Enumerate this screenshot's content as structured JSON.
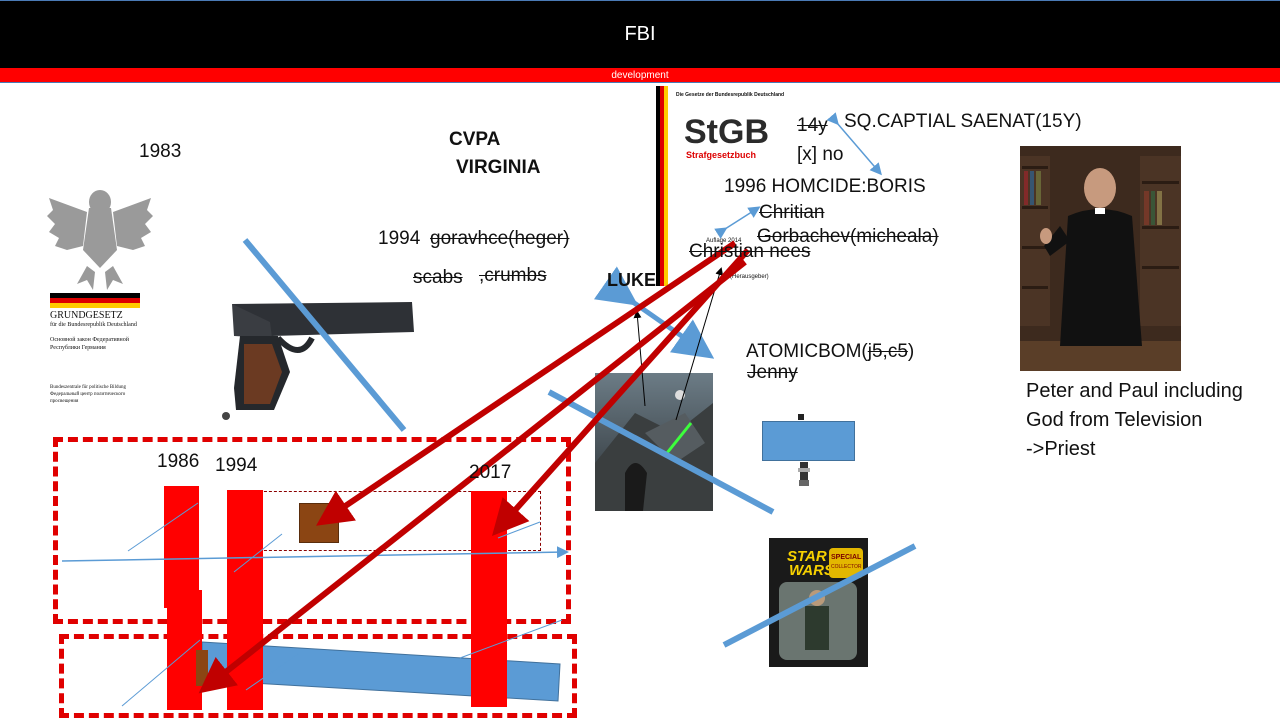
{
  "header": {
    "title": "FBI",
    "subtitle": "development"
  },
  "labels": {
    "year_1983": "1983",
    "cvpa": "CVPA",
    "virginia": "VIRGINIA",
    "year_1994": "1994",
    "goravhce": "goravhce(heger)",
    "scabs": "scabs",
    "crumbs": ",crumbs",
    "luke": "LUKE",
    "age_14y": "14y",
    "sq_captial": "SQ.CAPTIAL SAENAT(15Y)",
    "x_no": "[x] no",
    "homcide": "1996 HOMCIDE:BORIS",
    "chritian": "Chritian",
    "gorbachev": "Gorbachev(micheala)",
    "christian_nees": "Christian nees",
    "atomicbom": "ATOMICBOM(",
    "j5c5": "j5,c5",
    "paren_close": ")",
    "jenny": "Jenny",
    "peter_paul_1": "Peter and Paul including",
    "peter_paul_2": "God from Television",
    "peter_paul_3": "->Priest",
    "tl_1986": "1986",
    "tl_1994": "1994",
    "tl_2017": "2017"
  },
  "book_cover": {
    "header_text": "Die Gesetze der Bundesrepublik Deutschland",
    "logo": "StGB",
    "logo_sub": "Strafgesetzbuch",
    "edition": "Auflage 2014",
    "footer_text": "(Herausgeber)"
  },
  "grundgesetz": {
    "title": "GRUNDGESETZ",
    "subtitle": "für die Bundesrepublik Deutschland",
    "russian_1": "Основной закон Федеративной",
    "russian_2": "Республики Германия",
    "publisher_1": "Bundeszentrale für politische Bildung",
    "publisher_2": "Федеральный центр политического",
    "publisher_3": "просвещения"
  },
  "toy_card": {
    "brand_line1": "STAR",
    "brand_line2": "WARS",
    "badge": "SPECIAL",
    "badge2": "COLLECTOR"
  },
  "colors": {
    "arrow_red": "#c00000",
    "box_red": "#ff0000",
    "dash_red": "#e00000",
    "blue": "#5b9bd5",
    "brown": "#8b4513"
  }
}
